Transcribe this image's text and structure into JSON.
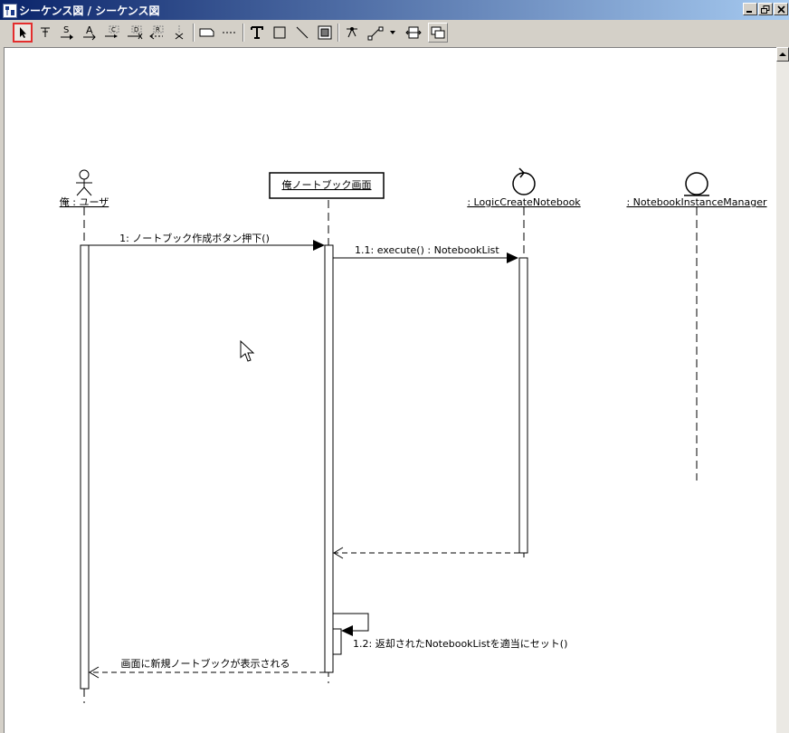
{
  "window": {
    "title": "シーケンス図 / シーケンス図"
  },
  "toolbar": {
    "items": [
      {
        "name": "select-tool-button",
        "icon": "arrow-cursor-icon",
        "selected": true
      },
      {
        "name": "stimulus-tool-button",
        "icon": "stimulus-icon"
      },
      {
        "name": "sync-message-tool-button",
        "icon": "sync-message-icon"
      },
      {
        "name": "async-message-tool-button",
        "icon": "async-message-icon"
      },
      {
        "name": "create-message-tool-button",
        "icon": "create-message-icon"
      },
      {
        "name": "destroy-message-tool-button",
        "icon": "destroy-message-icon"
      },
      {
        "name": "return-message-tool-button",
        "icon": "return-message-icon"
      },
      {
        "name": "terminate-tool-button",
        "icon": "terminate-icon"
      },
      {
        "name": "note-tool-button",
        "icon": "note-icon"
      },
      {
        "name": "note-anchor-tool-button",
        "icon": "note-anchor-icon"
      },
      {
        "name": "text-tool-button",
        "icon": "text-icon"
      },
      {
        "name": "rectangle-tool-button",
        "icon": "rectangle-icon"
      },
      {
        "name": "line-tool-button",
        "icon": "line-icon"
      },
      {
        "name": "image-tool-button",
        "icon": "image-icon"
      },
      {
        "name": "pin-tool-button",
        "icon": "pin-icon"
      },
      {
        "name": "line-style-tool-button",
        "icon": "line-style-icon"
      },
      {
        "name": "fit-size-tool-button",
        "icon": "fit-size-icon"
      },
      {
        "name": "overlap-toggle-button",
        "icon": "overlap-icon"
      }
    ]
  },
  "diagram": {
    "lifelines": [
      {
        "id": "user",
        "label": "俺 : ユーザ",
        "kind": "actor"
      },
      {
        "id": "screen",
        "label": "俺ノートブック画面",
        "kind": "object-box"
      },
      {
        "id": "logic",
        "label": ": LogicCreateNotebook",
        "kind": "control"
      },
      {
        "id": "manager",
        "label": ": NotebookInstanceManager",
        "kind": "entity"
      }
    ],
    "messages": [
      {
        "label": "1: ノートブック作成ボタン押下()",
        "from": "user",
        "to": "screen",
        "type": "sync"
      },
      {
        "label": "1.1: execute() : NotebookList",
        "from": "screen",
        "to": "logic",
        "type": "sync"
      },
      {
        "label": "",
        "from": "logic",
        "to": "screen",
        "type": "return"
      },
      {
        "label": "1.2: 返却されたNotebookListを適当にセット()",
        "from": "screen",
        "to": "screen",
        "type": "self"
      },
      {
        "label": "画面に新規ノートブックが表示される",
        "from": "screen",
        "to": "user",
        "type": "return"
      }
    ]
  },
  "colors": {
    "selection": "#e32d2d",
    "title_bar": "#0a246a"
  }
}
